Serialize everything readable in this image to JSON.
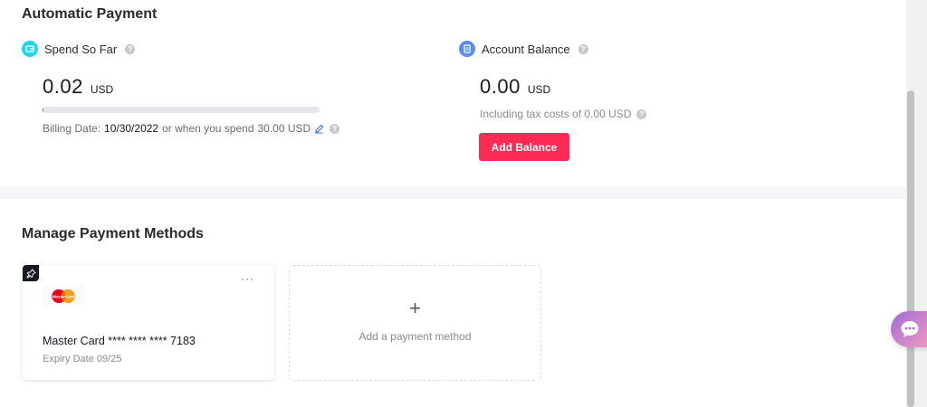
{
  "automatic_payment": {
    "title": "Automatic Payment",
    "spend": {
      "label": "Spend So Far",
      "amount": "0.02",
      "currency": "USD",
      "progress_fraction": 0.0007,
      "billing_prefix": "Billing Date:",
      "billing_date": "10/30/2022",
      "billing_mid": "or when you spend",
      "threshold": "30.00 USD"
    },
    "balance": {
      "label": "Account Balance",
      "amount": "0.00",
      "currency": "USD",
      "tax_text": "Including tax costs of 0.00 USD",
      "add_button": "Add Balance"
    }
  },
  "payment_methods": {
    "title": "Manage Payment Methods",
    "card": {
      "name": "Master Card **** **** **** 7183",
      "expiry": "Expiry Date 09/25",
      "more": "···",
      "logo_text": "MasterCard"
    },
    "add_label": "Add a payment method",
    "add_plus": "+"
  },
  "colors": {
    "accent": "#fe2c55",
    "spend_icon": "#20d5ec",
    "balance_icon": "#5b8def"
  },
  "icons": {
    "spend": "wallet-icon",
    "balance": "document-icon",
    "help": "help-circle-icon",
    "edit": "pencil-icon",
    "pin": "pin-icon",
    "chat": "chat-bubble-icon"
  }
}
